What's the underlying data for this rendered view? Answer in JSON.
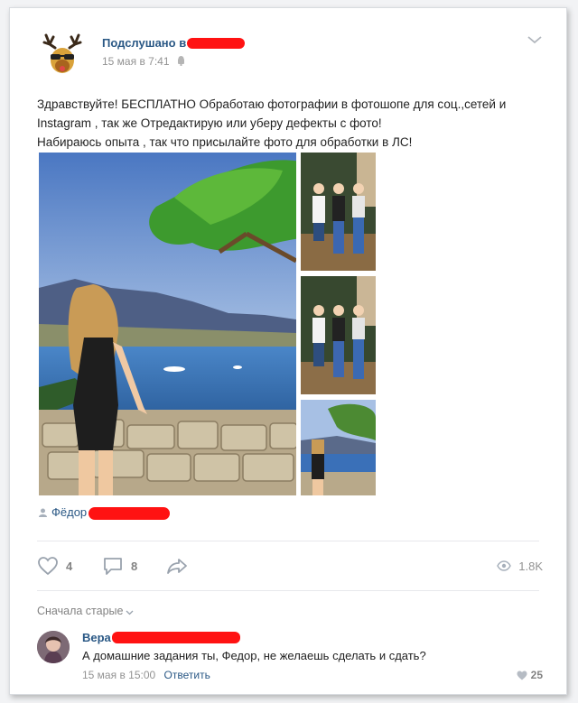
{
  "post": {
    "author": "Подслушано в",
    "time": "15 мая в 7:41",
    "text_lines": [
      "Здравствуйте! БЕСПЛАТНО Обработаю фотографии в фотошопе для соц.,сетей и",
      "Instagram , так же Отредактирую или уберу дефекты с фото!",
      "Набираюсь опыта , так что присылайте фото для обработки в ЛС!"
    ],
    "photo_author": "Фёдор"
  },
  "actions": {
    "likes": "4",
    "comments": "8",
    "views": "1.8K"
  },
  "comments_section": {
    "sort_label": "Сначала старые"
  },
  "comment": {
    "author": "Вера",
    "text": "А домашние задания ты, Федор, не желаешь сделать и сдать?",
    "time": "15 мая в 15:00",
    "reply_label": "Ответить",
    "likes": "25"
  },
  "colors": {
    "link": "#2a5885",
    "redaction": "#ff1212",
    "muted": "#939393"
  },
  "icons": [
    "deer-avatar-icon",
    "android-icon",
    "chevron-down-icon",
    "person-icon",
    "heart-icon",
    "comment-icon",
    "share-icon",
    "eye-icon"
  ]
}
